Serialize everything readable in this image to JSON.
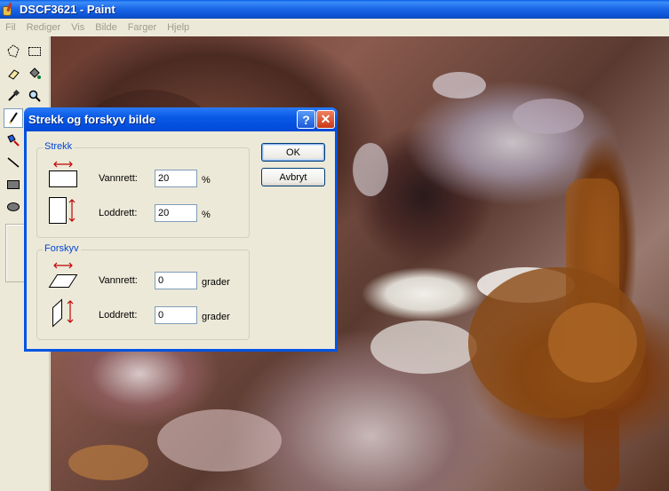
{
  "window": {
    "title": "DSCF3621 - Paint"
  },
  "menu": [
    "Fil",
    "Rediger",
    "Vis",
    "Bilde",
    "Farger",
    "Hjelp"
  ],
  "tools": [
    {
      "name": "free-select-icon"
    },
    {
      "name": "rect-select-icon"
    },
    {
      "name": "eraser-icon"
    },
    {
      "name": "fill-bucket-icon"
    },
    {
      "name": "color-picker-icon"
    },
    {
      "name": "magnifier-icon"
    },
    {
      "name": "pencil-icon",
      "selected": true
    },
    {
      "name": "brush-icon"
    },
    {
      "name": "airbrush-icon"
    },
    {
      "name": "text-icon"
    },
    {
      "name": "line-icon"
    },
    {
      "name": "curve-icon"
    },
    {
      "name": "rectangle-icon"
    },
    {
      "name": "polygon-icon"
    },
    {
      "name": "ellipse-icon"
    },
    {
      "name": "rounded-rect-icon"
    }
  ],
  "dialog": {
    "title": "Strekk og forskyv bilde",
    "help_label": "?",
    "close_label": "✕",
    "ok_label": "OK",
    "cancel_label": "Avbryt",
    "stretch": {
      "label": "Strekk",
      "horizontal_label": "Vannrett:",
      "horizontal_value": "20",
      "horizontal_unit": "%",
      "vertical_label": "Loddrett:",
      "vertical_value": "20",
      "vertical_unit": "%"
    },
    "skew": {
      "label": "Forskyv",
      "horizontal_label": "Vannrett:",
      "horizontal_value": "0",
      "horizontal_unit": "grader",
      "vertical_label": "Loddrett:",
      "vertical_value": "0",
      "vertical_unit": "grader"
    }
  },
  "colors": {
    "titlebar": "#0a5fe6",
    "group_label": "#0046d5",
    "arrow": "#c00000"
  }
}
